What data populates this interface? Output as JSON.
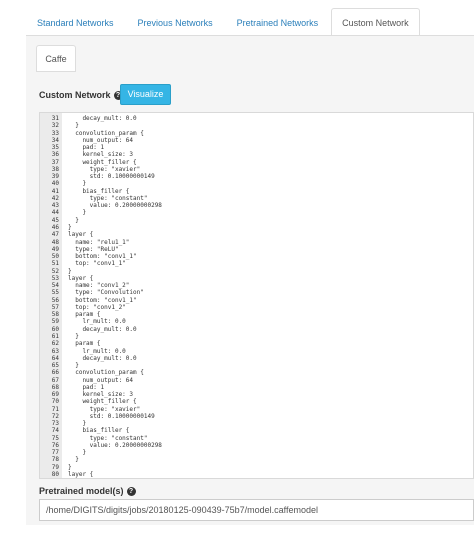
{
  "tabs": [
    {
      "label": "Standard Networks"
    },
    {
      "label": "Previous Networks"
    },
    {
      "label": "Pretrained Networks"
    },
    {
      "label": "Custom Network"
    }
  ],
  "sub_tab": {
    "label": "Caffe"
  },
  "custom_network": {
    "label": "Custom Network",
    "help": "?",
    "visualize_label": "Visualize"
  },
  "code_lines": [
    {
      "n": "31",
      "text": "    decay_mult: 0.0"
    },
    {
      "n": "32",
      "text": "  }"
    },
    {
      "n": "33",
      "text": "  convolution_param {"
    },
    {
      "n": "34",
      "text": "    num_output: 64"
    },
    {
      "n": "35",
      "text": "    pad: 1"
    },
    {
      "n": "36",
      "text": "    kernel_size: 3"
    },
    {
      "n": "37",
      "text": "    weight_filler {"
    },
    {
      "n": "38",
      "text": "      type: \"xavier\""
    },
    {
      "n": "39",
      "text": "      std: 0.10000000149"
    },
    {
      "n": "40",
      "text": "    }"
    },
    {
      "n": "41",
      "text": "    bias_filler {"
    },
    {
      "n": "42",
      "text": "      type: \"constant\""
    },
    {
      "n": "43",
      "text": "      value: 0.20000000298"
    },
    {
      "n": "44",
      "text": "    }"
    },
    {
      "n": "45",
      "text": "  }"
    },
    {
      "n": "46",
      "text": "}"
    },
    {
      "n": "47",
      "text": "layer {"
    },
    {
      "n": "48",
      "text": "  name: \"relu1_1\""
    },
    {
      "n": "49",
      "text": "  type: \"ReLU\""
    },
    {
      "n": "50",
      "text": "  bottom: \"conv1_1\""
    },
    {
      "n": "51",
      "text": "  top: \"conv1_1\""
    },
    {
      "n": "52",
      "text": "}"
    },
    {
      "n": "53",
      "text": "layer {"
    },
    {
      "n": "54",
      "text": "  name: \"conv1_2\""
    },
    {
      "n": "55",
      "text": "  type: \"Convolution\""
    },
    {
      "n": "56",
      "text": "  bottom: \"conv1_1\""
    },
    {
      "n": "57",
      "text": "  top: \"conv1_2\""
    },
    {
      "n": "58",
      "text": "  param {"
    },
    {
      "n": "59",
      "text": "    lr_mult: 0.0"
    },
    {
      "n": "60",
      "text": "    decay_mult: 0.0"
    },
    {
      "n": "61",
      "text": "  }"
    },
    {
      "n": "62",
      "text": "  param {"
    },
    {
      "n": "63",
      "text": "    lr_mult: 0.0"
    },
    {
      "n": "64",
      "text": "    decay_mult: 0.0"
    },
    {
      "n": "65",
      "text": "  }"
    },
    {
      "n": "66",
      "text": "  convolution_param {"
    },
    {
      "n": "67",
      "text": "    num_output: 64"
    },
    {
      "n": "68",
      "text": "    pad: 1"
    },
    {
      "n": "69",
      "text": "    kernel_size: 3"
    },
    {
      "n": "70",
      "text": "    weight_filler {"
    },
    {
      "n": "71",
      "text": "      type: \"xavier\""
    },
    {
      "n": "72",
      "text": "      std: 0.10000000149"
    },
    {
      "n": "73",
      "text": "    }"
    },
    {
      "n": "74",
      "text": "    bias_filler {"
    },
    {
      "n": "75",
      "text": "      type: \"constant\""
    },
    {
      "n": "76",
      "text": "      value: 0.20000000298"
    },
    {
      "n": "77",
      "text": "    }"
    },
    {
      "n": "78",
      "text": "  }"
    },
    {
      "n": "79",
      "text": "}"
    },
    {
      "n": "80",
      "text": "layer {"
    }
  ],
  "pretrained": {
    "label": "Pretrained model(s)",
    "help": "?",
    "value": "/home/DIGITS/digits/jobs/20180125-090439-75b7/model.caffemodel"
  }
}
